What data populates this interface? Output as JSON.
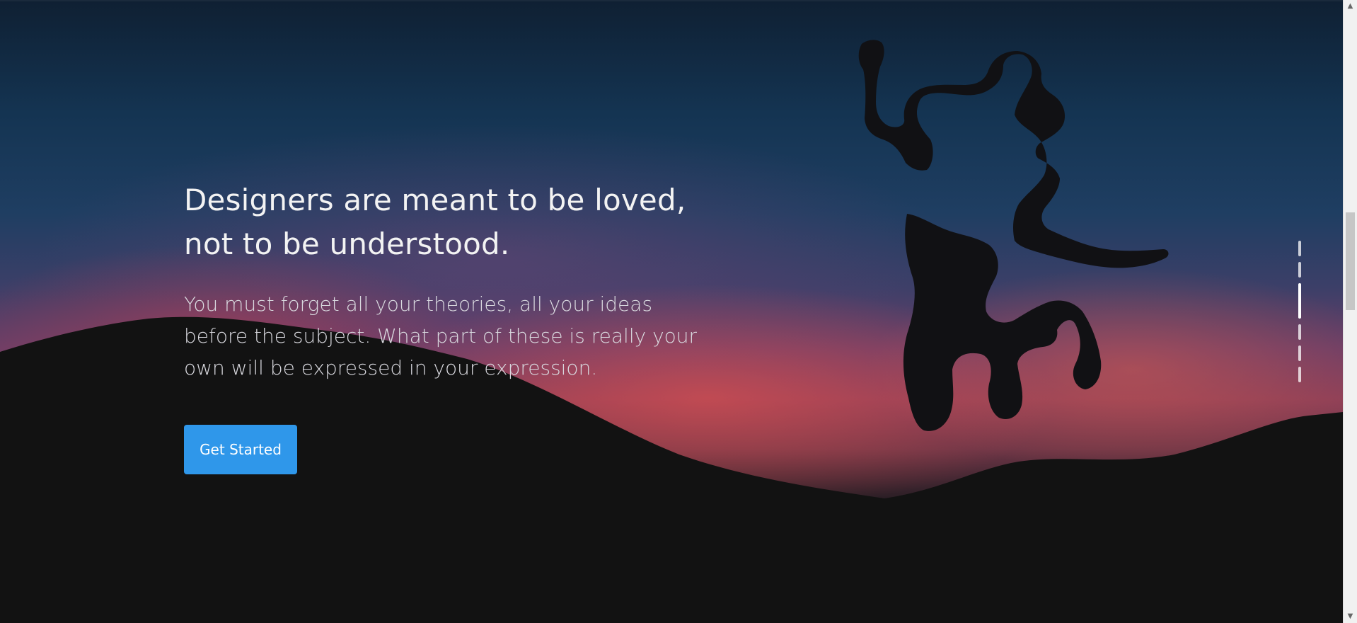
{
  "hero": {
    "title": "Designers are meant to be loved,\nnot to be understood.",
    "body": "You must forget all your theories, all your ideas before the subject. What part of these is really your own will be expressed in your expression.",
    "cta_label": "Get Started"
  },
  "dot_nav": {
    "count": 6,
    "active_index": 2
  },
  "scrollbar": {
    "up_glyph": "▲",
    "down_glyph": "▼"
  },
  "colors": {
    "cta": "#2f97ea",
    "text": "#f3f3f3"
  },
  "background": {
    "image": "silhouette-person-jumping-over-hills-at-sunset"
  }
}
